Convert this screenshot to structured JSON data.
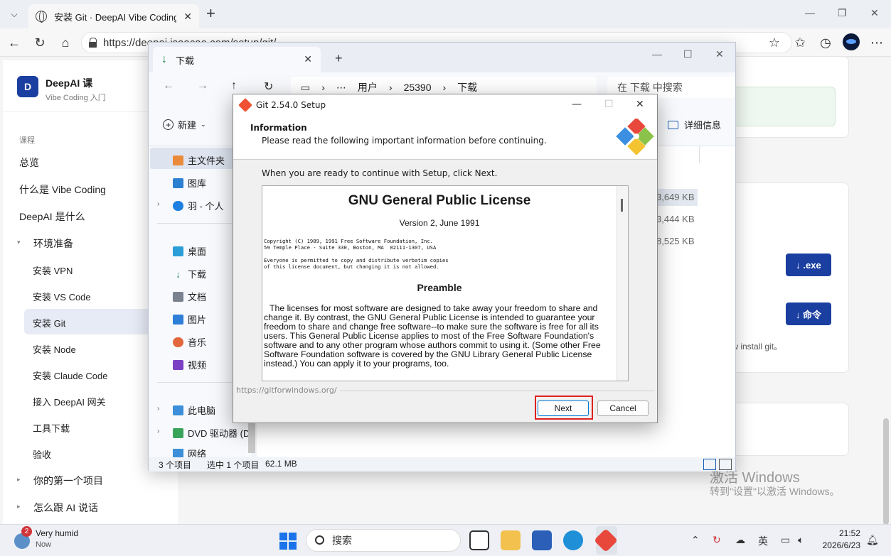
{
  "browser": {
    "tab_title": "安装 Git · DeepAI Vibe Coding 课",
    "url": "https://deepai.isaacao.com/setup/git/"
  },
  "sidebar": {
    "brand": "DeepAI 课",
    "brand_sub": "Vibe Coding 入门",
    "section": "课程",
    "items": [
      "总览",
      "什么是 Vibe Coding",
      "DeepAI 是什么",
      "环境准备"
    ],
    "sub_items": [
      "安装 VPN",
      "安装 VS Code",
      "安装 Git",
      "安装 Node",
      "安装 Claude Code",
      "接入 DeepAI 网关",
      "工具下载",
      "验收"
    ],
    "bottom_items": [
      "你的第一个项目",
      "怎么跟 AI 说话"
    ]
  },
  "content": {
    "btn_exe": "↓ .exe",
    "btn_cmd": "↓ 命令",
    "hint": "brew install git。",
    "activate_title": "激活 Windows",
    "activate_sub": "转到\"设置\"以激活 Windows。"
  },
  "explorer": {
    "tab_title": "下载",
    "path": [
      "用户",
      "25390",
      "下载"
    ],
    "search_placeholder": "在 下载 中搜索",
    "new_label": "新建",
    "details_label": "详细信息",
    "nav": [
      "主文件夹",
      "图库",
      "羽 - 个人",
      "桌面",
      "下载",
      "文档",
      "图片",
      "音乐",
      "视频",
      "此电脑",
      "DVD 驱动器 (D",
      "网络"
    ],
    "sizes": [
      "3,649 KB",
      "3,444 KB",
      "8,525 KB"
    ],
    "status_count": "3 个项目",
    "status_selected": "选中 1 个项目",
    "status_size": "62.1 MB"
  },
  "dialog": {
    "title": "Git 2.54.0 Setup",
    "heading": "Information",
    "subheading": "Please read the following important information before continuing.",
    "intro": "When you are ready to continue with Setup, click Next.",
    "license_title": "GNU General Public License",
    "license_version": "Version 2, June 1991",
    "copyright": "Copyright (C) 1989, 1991 Free Software Foundation, Inc.\n59 Temple Place - Suite 330, Boston, MA  02111-1307, USA",
    "permission": "Everyone is permitted to copy and distribute verbatim copies\nof this license document, but changing it is not allowed.",
    "preamble_title": "Preamble",
    "preamble_text": "The licenses for most software are designed to take away your freedom to share and change it. By contrast, the GNU General Public License is intended to guarantee your freedom to share and change free software--to make sure the software is free for all its users. This General Public License applies to most of the Free Software Foundation's software and to any other program whose authors commit to using it. (Some other Free Software Foundation software is covered by the GNU Library General Public License instead.) You can apply it to your programs, too.",
    "footer_url": "https://gitforwindows.org/",
    "next_label": "Next",
    "cancel_label": "Cancel"
  },
  "taskbar": {
    "weather": "Very humid",
    "weather_sub": "Now",
    "badge": "2",
    "search": "搜索",
    "ime": "英",
    "time": "21:52",
    "date": "2026/6/23"
  }
}
